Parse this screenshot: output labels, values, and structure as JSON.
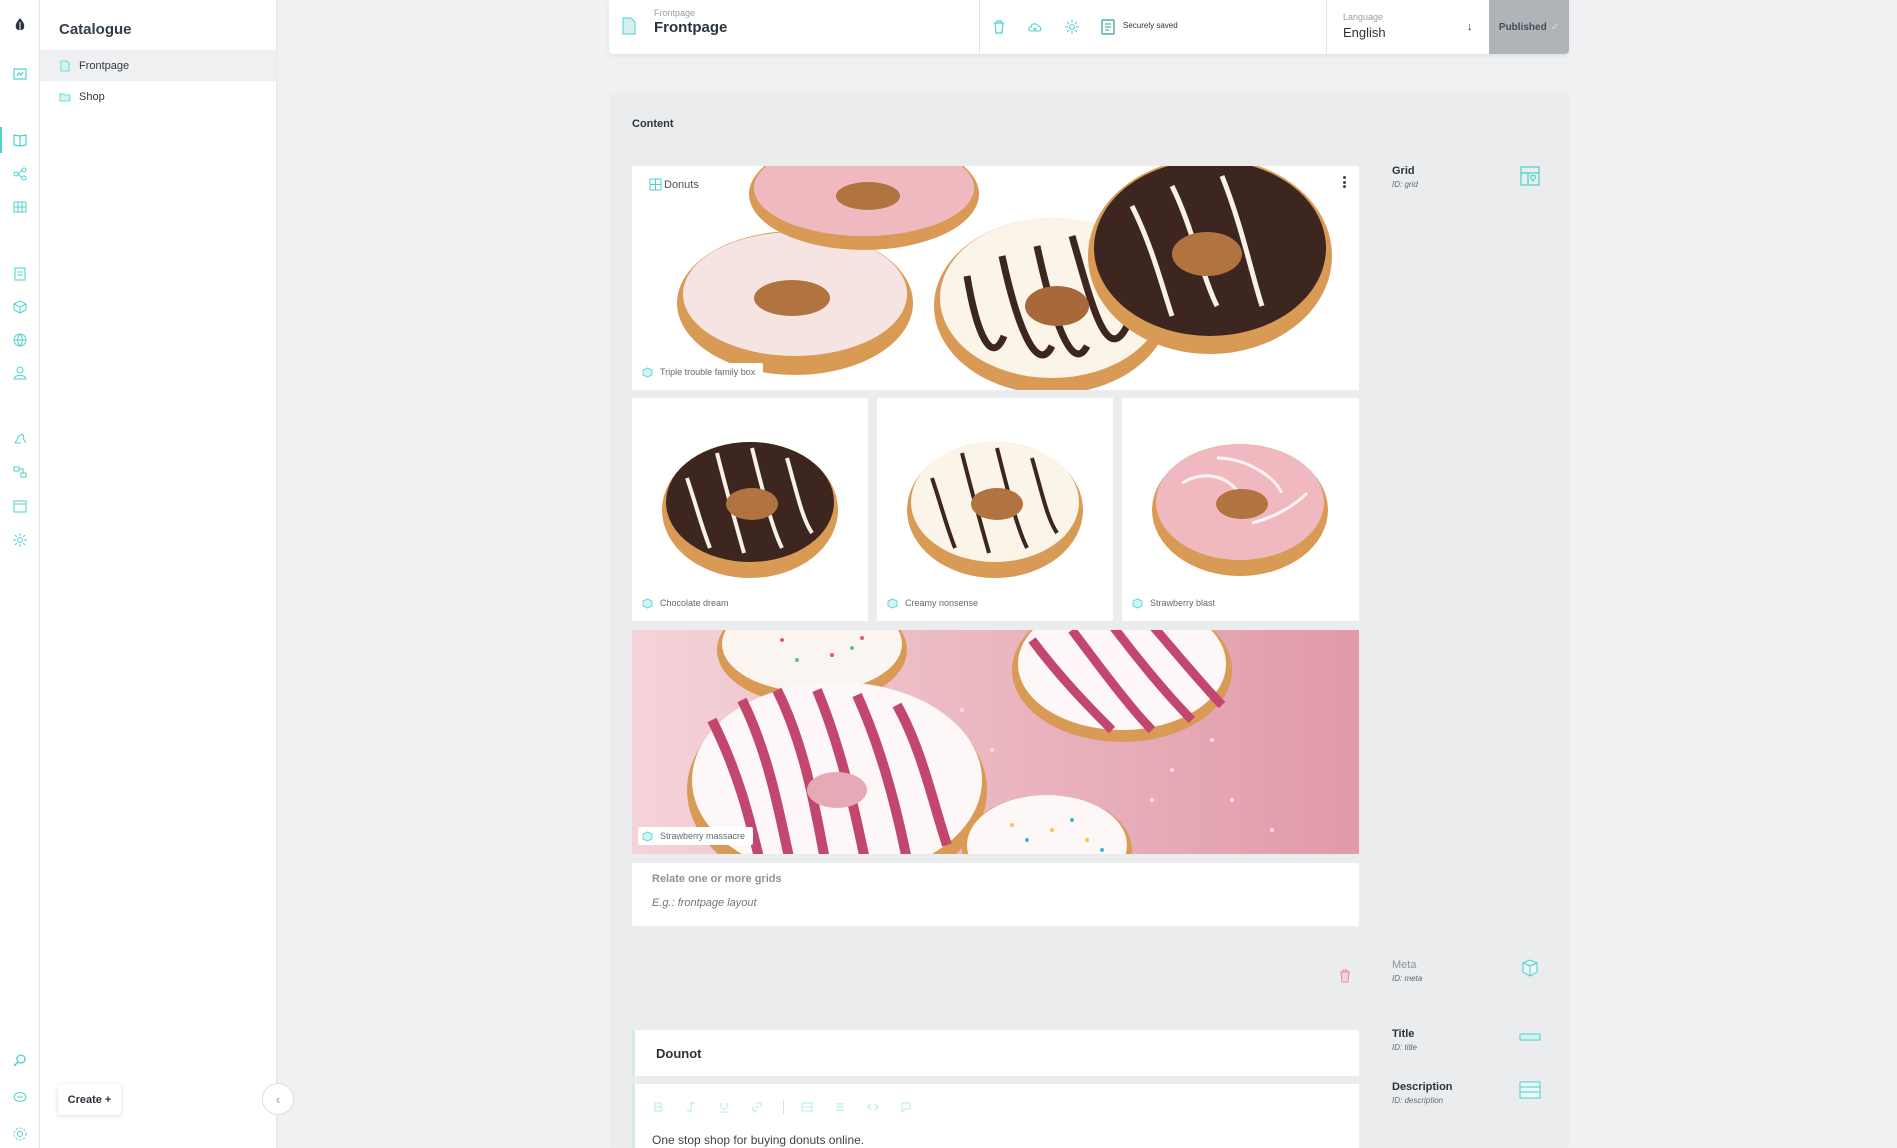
{
  "rail": {
    "icons": [
      "logo-icon",
      "dashboard-icon",
      "catalogue-icon",
      "topics-icon",
      "grids-icon",
      "orders-icon",
      "shapes-icon",
      "globe-icon",
      "users-icon",
      "webhooks-icon",
      "pipelines-icon",
      "calendar-icon",
      "settings-icon",
      "search-icon",
      "support-icon",
      "profile-icon"
    ]
  },
  "tree": {
    "title": "Catalogue",
    "items": [
      {
        "label": "Frontpage",
        "icon": "document-icon"
      },
      {
        "label": "Shop",
        "icon": "folder-icon"
      }
    ],
    "create_label": "Create +",
    "collapse_glyph": "‹"
  },
  "topbar": {
    "subtitle": "Frontpage",
    "title": "Frontpage",
    "saved_label": "Securely saved",
    "language_label": "Language",
    "language_value": "English",
    "language_arrow": "↓",
    "publish_label": "Published",
    "publish_check": "✓"
  },
  "content": {
    "heading": "Content",
    "grid_name": "Donuts",
    "cells": [
      {
        "label": "Triple trouble family box"
      },
      {
        "label": "Chocolate dream"
      },
      {
        "label": "Creamy nonsense"
      },
      {
        "label": "Strawberry blast"
      },
      {
        "label": "Strawberry massacre"
      }
    ],
    "relate": {
      "title": "Relate one or more grids",
      "placeholder": "E.g.: frontpage layout"
    },
    "title_value": "Dounot",
    "description_value": "One stop shop for buying donuts online."
  },
  "components": {
    "grid": {
      "name": "Grid",
      "id": "ID: grid"
    },
    "meta": {
      "name": "Meta",
      "id": "ID: meta"
    },
    "title": {
      "name": "Title",
      "id": "ID: title"
    },
    "description": {
      "name": "Description",
      "id": "ID: description"
    }
  },
  "colors": {
    "accent": "#4bd1cf",
    "publish_bg": "#aeb4b8",
    "panel_bg": "#ebeced",
    "chocolate": "#3e2620",
    "pink_glaze": "#f0b9c0",
    "dough": "#d99a55",
    "massacre_bg": "#e8a4b0"
  }
}
